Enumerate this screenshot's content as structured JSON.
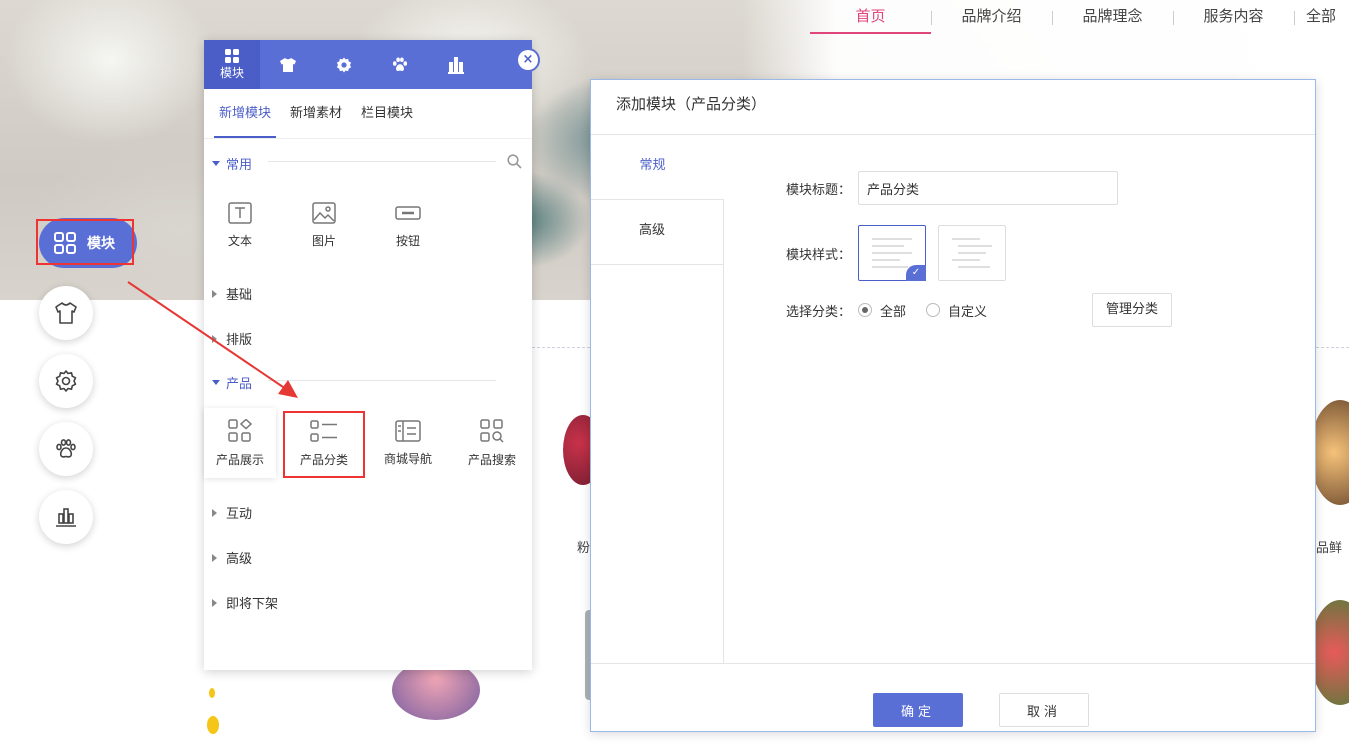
{
  "nav": {
    "items": [
      "首页",
      "品牌介绍",
      "品牌理念",
      "服务内容",
      "全部"
    ]
  },
  "float_bar": {
    "module_label": "模块",
    "buttons": [
      "shirt-icon",
      "gear-icon",
      "paw-icon",
      "chart-icon"
    ]
  },
  "panel": {
    "tabs": [
      {
        "icon": "grid-icon",
        "label": "模块"
      },
      {
        "icon": "shirt-icon",
        "label": ""
      },
      {
        "icon": "gear-icon",
        "label": ""
      },
      {
        "icon": "paw-icon",
        "label": ""
      },
      {
        "icon": "chart-icon",
        "label": ""
      }
    ],
    "close": "×",
    "sub_tabs": [
      "新增模块",
      "新增素材",
      "栏目模块"
    ],
    "groups": {
      "common": "常用",
      "basic": "基础",
      "layout": "排版",
      "product": "产品",
      "interact": "互动",
      "advanced": "高级",
      "deprecated": "即将下架"
    },
    "common_items": [
      "文本",
      "图片",
      "按钮"
    ],
    "product_items": [
      "产品展示",
      "产品分类",
      "商城导航",
      "产品搜索"
    ]
  },
  "dialog": {
    "title": "添加模块（产品分类）",
    "side_tabs": [
      "常规",
      "高级"
    ],
    "title_label": "模块标题：",
    "title_value": "产品分类",
    "style_label": "模块样式：",
    "category_label": "选择分类：",
    "radio_all": "全部",
    "radio_custom": "自定义",
    "manage_button": "管理分类",
    "ok": "确定",
    "cancel": "取消"
  },
  "background": {
    "partial_left": "粉",
    "partial_right": "品鲜"
  }
}
